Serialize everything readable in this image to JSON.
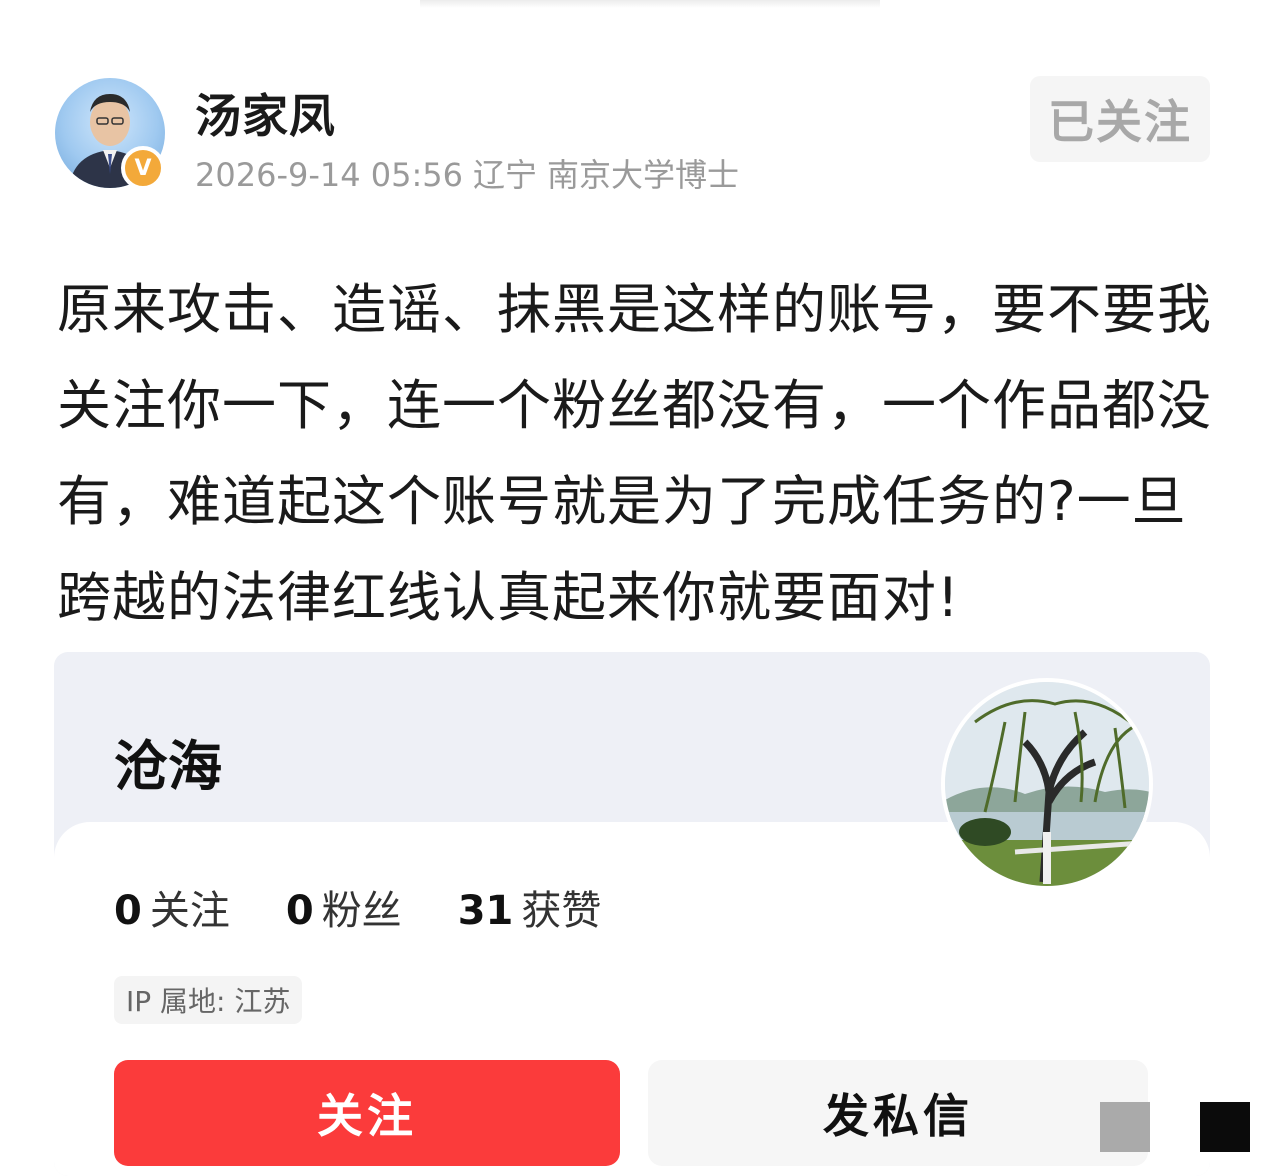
{
  "post": {
    "author": "汤家凤",
    "verified_badge": "V",
    "meta": {
      "datetime": "2026-9-14 05:56",
      "location": "辽宁",
      "title": "南京大学博士"
    },
    "follow_status": "已关注",
    "text": "原来攻击、造谣、抹黑是这样的账号，要不要我关注你一下，连一个粉丝都没有，一个作品都没有，难道起这个账号就是为了完成任务的?一旦跨越的法律红线认真起来你就要面对!"
  },
  "profile_card": {
    "name": "沧海",
    "stats": [
      {
        "count": "0",
        "label": "关注"
      },
      {
        "count": "0",
        "label": "粉丝"
      },
      {
        "count": "31",
        "label": "获赞"
      }
    ],
    "ip_location": "IP 属地: 江苏",
    "follow_button": "关注",
    "message_button": "发私信"
  },
  "colors": {
    "follow_button": "#fb3b3b",
    "badge": "#f3a93a",
    "meta_text": "#9a9a9a"
  }
}
